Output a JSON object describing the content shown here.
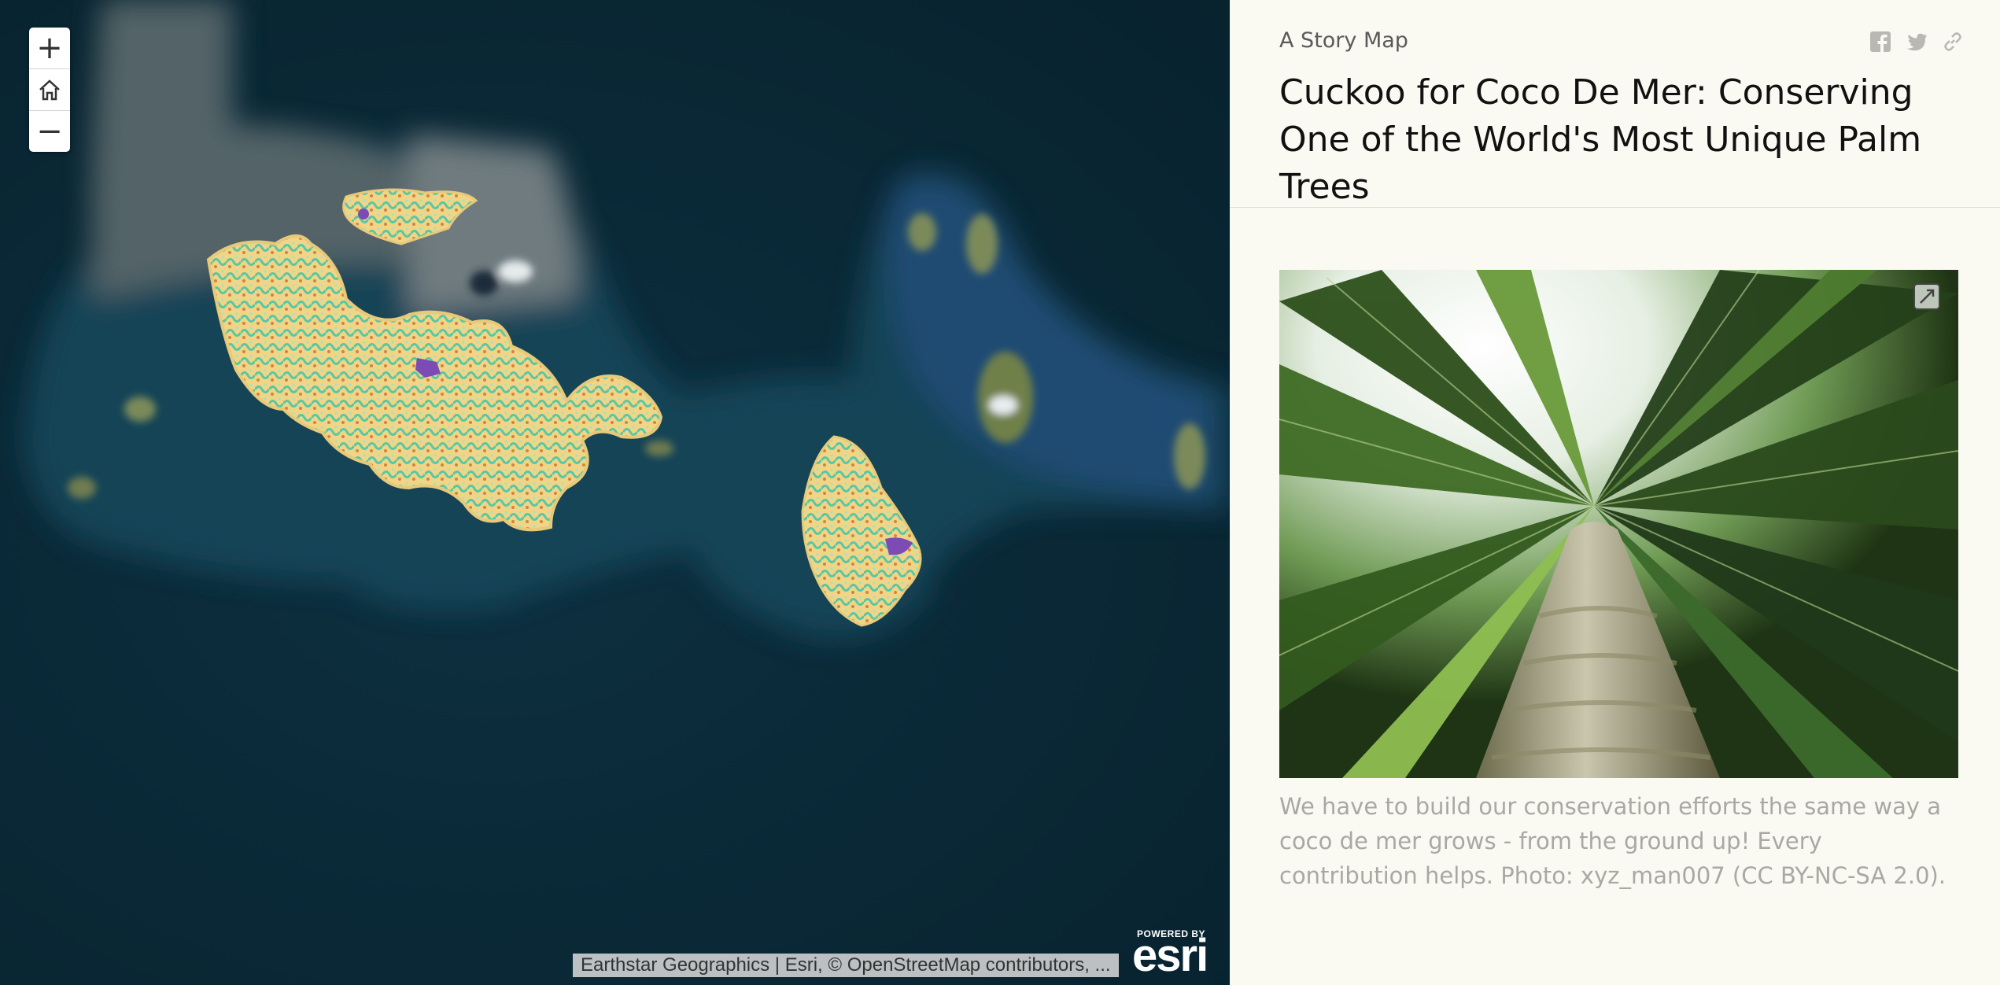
{
  "map": {
    "zoom_in_label": "+",
    "zoom_out_label": "−",
    "home_icon": "home-icon",
    "attribution": "Earthstar Geographics | Esri, © OpenStreetMap contributors, ...",
    "logo": {
      "powered_by": "POWERED BY",
      "word": "esri"
    }
  },
  "panel": {
    "kicker": "A Story Map",
    "share_icons": [
      "facebook-icon",
      "twitter-icon",
      "link-icon"
    ],
    "title": "Cuckoo for Coco De Mer: Conserving One of the World's Most Unique Palm Trees",
    "image": {
      "expand_icon": "expand-icon"
    },
    "caption": "We have to build our conservation efforts the same way a coco de mer grows - from the ground up! Every contribution helps. Photo: xyz_man007 (CC BY-NC-SA 2.0)."
  },
  "colors": {
    "ocean": "#0a2734",
    "panel_bg": "#faf9f2",
    "land_yellow": "#f2d78a",
    "land_teal": "#5fc9a6",
    "land_purple": "#7c4bb5"
  }
}
